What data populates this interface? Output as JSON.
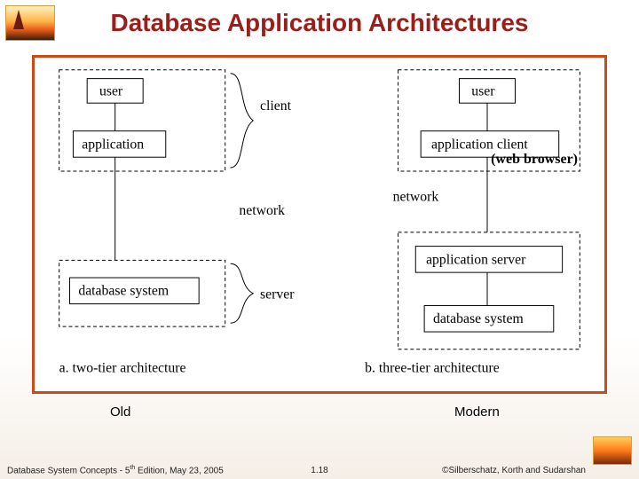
{
  "title": "Database Application Architectures",
  "annotation": "(web browser)",
  "left": {
    "user": "user",
    "application": "application",
    "database_system": "database system",
    "client": "client",
    "network": "network",
    "server": "server",
    "caption": "a.   two-tier architecture"
  },
  "right": {
    "user": "user",
    "application_client": "application client",
    "application_server": "application server",
    "database_system": "database system",
    "caption": "b.   three-tier architecture"
  },
  "labels": {
    "old": "Old",
    "modern": "Modern"
  },
  "footer": {
    "left_prefix": "Database System Concepts - 5",
    "left_sup": "th",
    "left_suffix": " Edition, May 23,  2005",
    "center": "1.18",
    "right": "©Silberschatz, Korth and Sudarshan"
  }
}
